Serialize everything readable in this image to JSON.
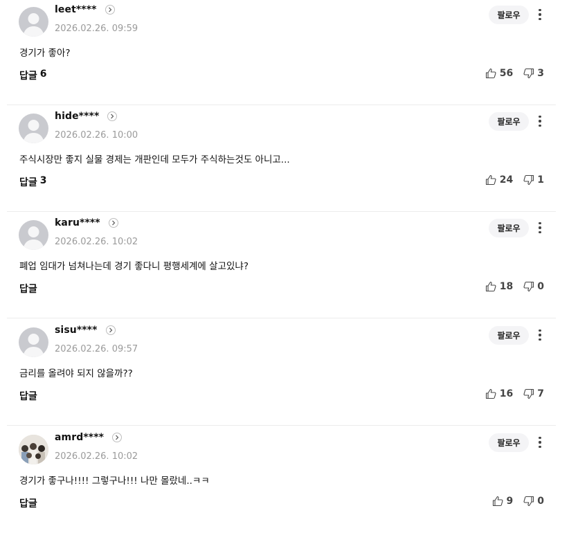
{
  "comments": [
    {
      "nickname": "leet****",
      "date": "2026.02.26. 09:59",
      "text": "경기가 좋아?",
      "follow_label": "팔로우",
      "reply_label": "답글",
      "reply_count": "6",
      "likes": "56",
      "dislikes": "3",
      "avatar": "default-avatar"
    },
    {
      "nickname": "hide****",
      "date": "2026.02.26. 10:00",
      "text": "주식시장만 좋지 실물 경제는 개판인데 모두가 주식하는것도 아니고...",
      "follow_label": "팔로우",
      "reply_label": "답글",
      "reply_count": "3",
      "likes": "24",
      "dislikes": "1",
      "avatar": "default-avatar"
    },
    {
      "nickname": "karu****",
      "date": "2026.02.26. 10:02",
      "text": "폐업 임대가 넘쳐나는데 경기 좋다니 평행세계에 살고있냐?",
      "follow_label": "팔로우",
      "reply_label": "답글",
      "reply_count": "",
      "likes": "18",
      "dislikes": "0",
      "avatar": "default-avatar"
    },
    {
      "nickname": "sisu****",
      "date": "2026.02.26. 09:57",
      "text": "금리를 올려야 되지 않을까??",
      "follow_label": "팔로우",
      "reply_label": "답글",
      "reply_count": "",
      "likes": "16",
      "dislikes": "7",
      "avatar": "default-avatar"
    },
    {
      "nickname": "amrd****",
      "date": "2026.02.26. 10:02",
      "text": "경기가 좋구나!!!! 그렇구나!!! 나만 몰랐네..ㅋㅋ",
      "follow_label": "팔로우",
      "reply_label": "답글",
      "reply_count": "",
      "likes": "9",
      "dislikes": "0",
      "avatar": "photo-avatar"
    }
  ],
  "colors": {
    "avatar_bg": "#c9cacf",
    "follow_bg": "#f4f4f6",
    "date_text": "#9a9a9a",
    "divider": "#ececec"
  }
}
